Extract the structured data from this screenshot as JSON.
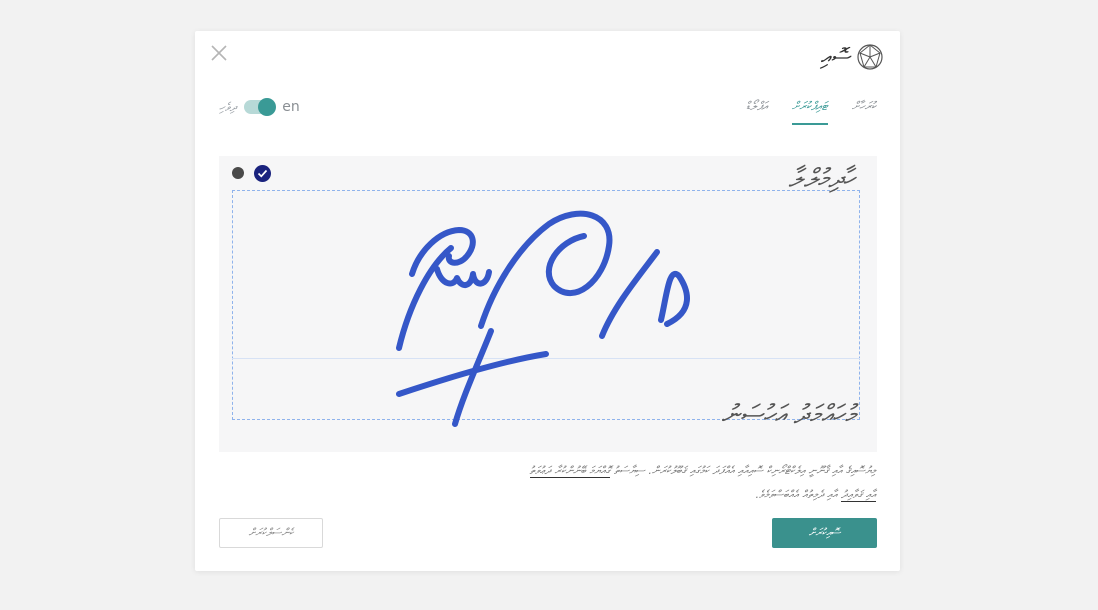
{
  "header": {
    "title": "ސޮއި",
    "logo_icon": "crystal-logo-icon",
    "close_icon": "close-icon"
  },
  "language": {
    "label": "ދިވެހި",
    "code": "en",
    "toggle_on": true
  },
  "tabs": [
    {
      "label": "ކުރަހާށް",
      "active": false
    },
    {
      "label": "ޓައިޕްކުރަށް",
      "active": true
    },
    {
      "label": "އަޕްލޯޑް",
      "active": false
    }
  ],
  "canvas": {
    "title": "ހާދިމުލްލާ",
    "footer_line": "މުހައްމަދު އަހުސަނު",
    "pen_colors": [
      "#4a4a4a",
      "#1a237e"
    ],
    "selected_pen": 1,
    "ink_color": "#3557c8"
  },
  "consent": {
    "text": "މިޔުސޮއިޤެ އާއި ޤާނޫނީ އިލެކްޓްރޯނިކް ސޮއިއާއި އެއްފަދަ ކަމުގައި ޤަބޫލުކުރަން. ސިޔާސަތު ",
    "link": "ގޮއްޔަމަ ބޭނުންކުރާ ދަޢުވަތު އާއި ޤަވާއިދު",
    "tail": " އާއި ދެމިތުއް އެއްބަސްވަމެވެ."
  },
  "buttons": {
    "secondary_label": "ކެންސަލްކުރަށް",
    "primary_label": "ސޮއިކުރަށް"
  },
  "colors": {
    "accent": "#3a918d",
    "ink": "#3557c8",
    "dashed": "#8fb3ec"
  }
}
